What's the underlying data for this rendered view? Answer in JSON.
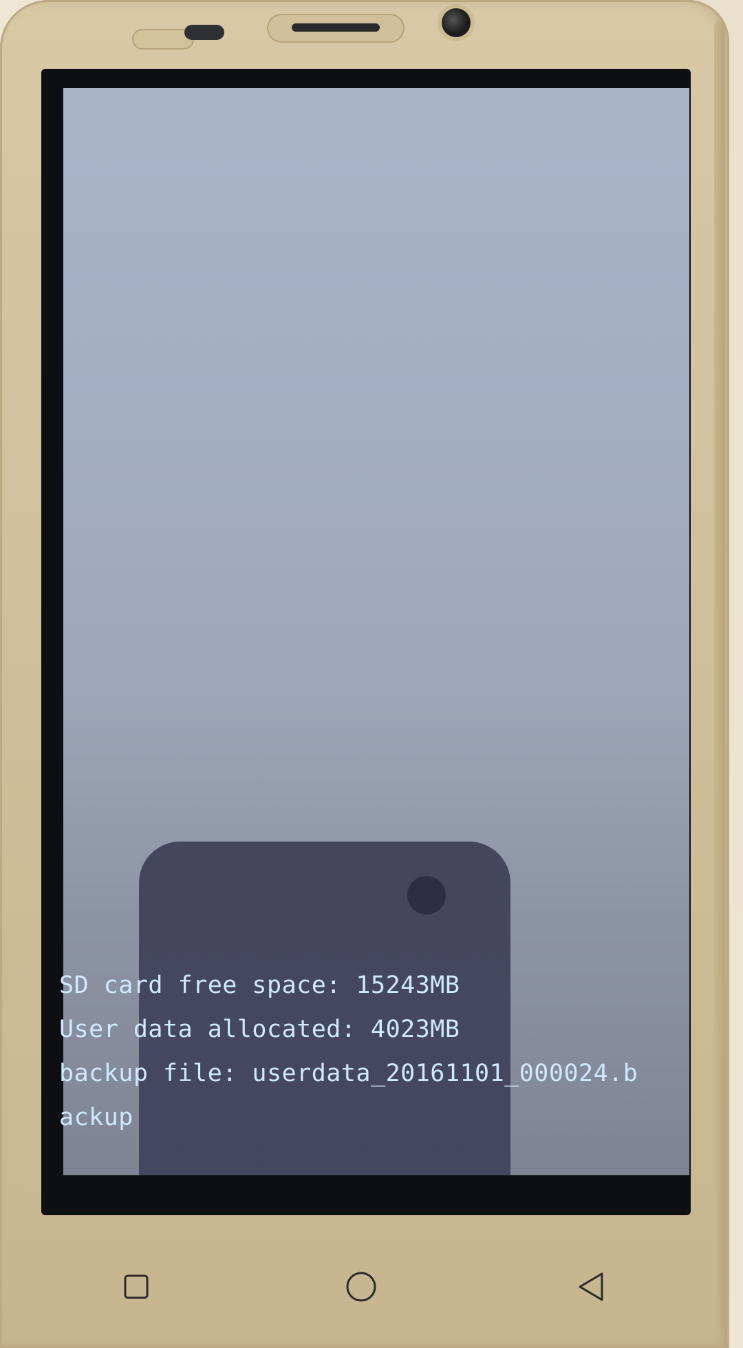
{
  "recovery_console": {
    "lines": [
      "SD card free space: 15243MB",
      "User data allocated: 4023MB",
      "backup file: userdata_20161101_000024.b",
      "ackup"
    ]
  },
  "navigation": {
    "buttons": [
      {
        "icon": "recent-apps-icon"
      },
      {
        "icon": "home-icon"
      },
      {
        "icon": "back-icon"
      }
    ]
  },
  "colors": {
    "console_text": "#cfe9ff",
    "screen_background": "#a4aec3",
    "bezel_gold": "#d3c29f"
  }
}
